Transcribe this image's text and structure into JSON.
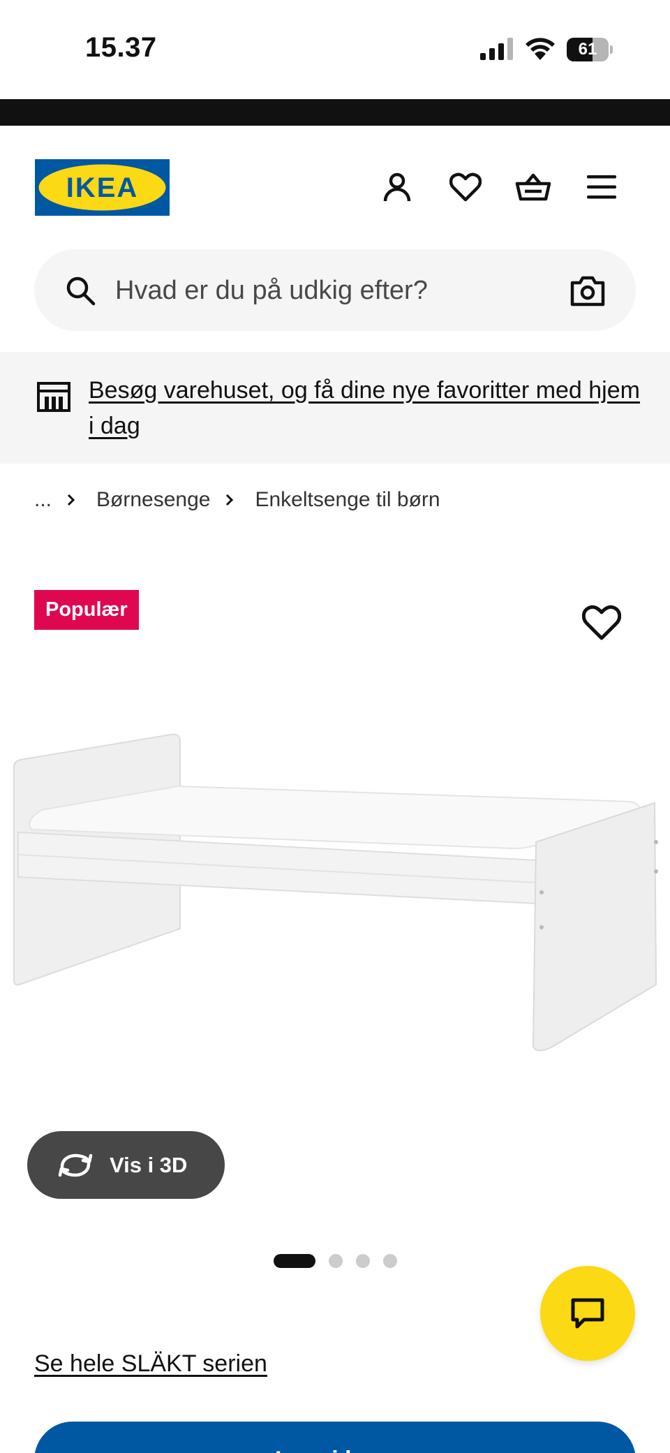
{
  "status_bar": {
    "time": "15.37",
    "battery_level": "61",
    "battery_fraction": 0.61
  },
  "header": {
    "logo_text": "IKEA",
    "icons": [
      "user-icon",
      "heart-icon",
      "cart-icon",
      "menu-icon"
    ]
  },
  "search": {
    "placeholder": "Hvad er du på udkig efter?",
    "value": ""
  },
  "store_banner": {
    "text": "Besøg varehuset, og få dine nye favoritter med hjem i dag"
  },
  "breadcrumb": {
    "items": [
      "...",
      "Børnesenge",
      "Enkeltsenge til børn"
    ]
  },
  "product": {
    "badge": "Populær",
    "view_3d_label": "Vis i 3D",
    "image_count": 4,
    "active_image": 1,
    "series_link": "Se hele SLÄKT serien",
    "cta_label": "Læg i kurv"
  },
  "colors": {
    "ikea_blue": "#0058a3",
    "ikea_yellow": "#fbd914",
    "badge_red": "#e00751",
    "dark_button": "#474747",
    "banner_bg": "#f5f5f5"
  }
}
